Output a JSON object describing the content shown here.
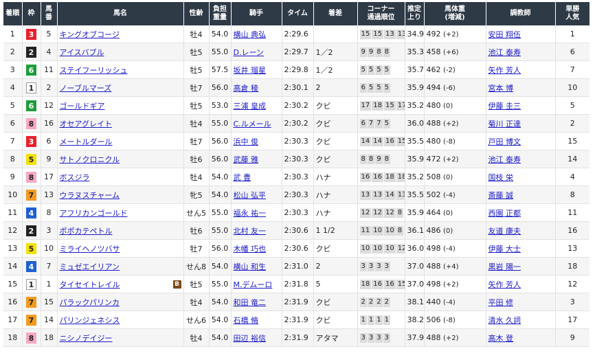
{
  "headers": [
    "着順",
    "枠",
    "馬番",
    "馬名",
    "性齢",
    "負担重量",
    "騎手",
    "タイム",
    "着差",
    "コーナー通過順位",
    "推定上り",
    "馬体重(増減)",
    "調教師",
    "単勝人気"
  ],
  "header_lines": {
    "h2": [
      "馬",
      "番"
    ],
    "h5": [
      "負担",
      "重量"
    ],
    "h9": [
      "コーナー",
      "通過順位"
    ],
    "h10": [
      "推定",
      "上り"
    ],
    "h11": [
      "馬体重",
      "(増減)"
    ],
    "h13": [
      "単勝",
      "人気"
    ]
  },
  "waku_colors": {
    "1": {
      "bg": "#ffffff",
      "fg": "#222222",
      "border": "#999999"
    },
    "2": {
      "bg": "#222222",
      "fg": "#ffffff",
      "border": "#222222"
    },
    "3": {
      "bg": "#e8202a",
      "fg": "#ffffff",
      "border": "#e8202a"
    },
    "4": {
      "bg": "#1f5fd0",
      "fg": "#ffffff",
      "border": "#1f5fd0"
    },
    "5": {
      "bg": "#f5e000",
      "fg": "#222222",
      "border": "#f5e000"
    },
    "6": {
      "bg": "#1e9e3a",
      "fg": "#ffffff",
      "border": "#1e9e3a"
    },
    "7": {
      "bg": "#f39a1e",
      "fg": "#222222",
      "border": "#f39a1e"
    },
    "8": {
      "bg": "#f6a8c2",
      "fg": "#222222",
      "border": "#f6a8c2"
    }
  },
  "rows": [
    {
      "rank": "1",
      "waku": "3",
      "num": "5",
      "horse": "キングオブコージ",
      "blinker": "",
      "sex_age": "牡4",
      "weight": "54.0",
      "jockey": "横山 典弘",
      "time": "2:29.6",
      "margin": "",
      "corners": [
        "15",
        "15",
        "13",
        "13"
      ],
      "last3f": "34.9",
      "body": "492",
      "diff": "(+2)",
      "trainer": "安田 翔伍",
      "pop": "1"
    },
    {
      "rank": "2",
      "waku": "2",
      "num": "4",
      "horse": "アイスバブル",
      "blinker": "",
      "sex_age": "牡5",
      "weight": "55.0",
      "jockey": "D.レーン",
      "time": "2:29.7",
      "margin": "1／2",
      "corners": [
        "9",
        "9",
        "8",
        "8"
      ],
      "last3f": "35.3",
      "body": "458",
      "diff": "(+6)",
      "trainer": "池江 泰寿",
      "pop": "6"
    },
    {
      "rank": "3",
      "waku": "6",
      "num": "11",
      "horse": "ステイフーリッシュ",
      "blinker": "",
      "sex_age": "牡5",
      "weight": "57.5",
      "jockey": "坂井 瑠星",
      "time": "2:29.8",
      "margin": "1／2",
      "corners": [
        "5",
        "5",
        "5",
        "5"
      ],
      "last3f": "35.7",
      "body": "462",
      "diff": "(-2)",
      "trainer": "矢作 芳人",
      "pop": "7"
    },
    {
      "rank": "4",
      "waku": "1",
      "num": "2",
      "horse": "ノーブルマーズ",
      "blinker": "",
      "sex_age": "牡7",
      "weight": "56.0",
      "jockey": "高倉 稜",
      "time": "2:30.1",
      "margin": "2",
      "corners": [
        "6",
        "5",
        "5",
        "5"
      ],
      "last3f": "35.9",
      "body": "494",
      "diff": "(-6)",
      "trainer": "宮本 博",
      "pop": "10"
    },
    {
      "rank": "5",
      "waku": "6",
      "num": "12",
      "horse": "ゴールドギア",
      "blinker": "",
      "sex_age": "牡5",
      "weight": "53.0",
      "jockey": "三浦 皇成",
      "time": "2:30.2",
      "margin": "クビ",
      "corners": [
        "17",
        "18",
        "15",
        "17"
      ],
      "last3f": "35.2",
      "body": "480",
      "diff": "(0)",
      "trainer": "伊藤 圭三",
      "pop": "5"
    },
    {
      "rank": "6",
      "waku": "8",
      "num": "16",
      "horse": "オセアグレイト",
      "blinker": "",
      "sex_age": "牡4",
      "weight": "55.0",
      "jockey": "C.ルメール",
      "time": "2:30.2",
      "margin": "クビ",
      "corners": [
        "6",
        "7",
        "7",
        "5"
      ],
      "last3f": "36.0",
      "body": "488",
      "diff": "(+2)",
      "trainer": "菊川 正達",
      "pop": "2"
    },
    {
      "rank": "7",
      "waku": "3",
      "num": "6",
      "horse": "メートルダール",
      "blinker": "",
      "sex_age": "牡7",
      "weight": "56.0",
      "jockey": "浜中 俊",
      "time": "2:30.3",
      "margin": "クビ",
      "corners": [
        "14",
        "14",
        "16",
        "15"
      ],
      "last3f": "35.5",
      "body": "480",
      "diff": "(-8)",
      "trainer": "戸田 博文",
      "pop": "15"
    },
    {
      "rank": "8",
      "waku": "5",
      "num": "9",
      "horse": "サトノクロニクル",
      "blinker": "",
      "sex_age": "牡6",
      "weight": "56.0",
      "jockey": "武藤 雅",
      "time": "2:30.3",
      "margin": "クビ",
      "corners": [
        "8",
        "8",
        "9",
        "8"
      ],
      "last3f": "35.9",
      "body": "472",
      "diff": "(+2)",
      "trainer": "池江 泰寿",
      "pop": "14"
    },
    {
      "rank": "9",
      "waku": "8",
      "num": "17",
      "horse": "ボスジラ",
      "blinker": "",
      "sex_age": "牡4",
      "weight": "54.0",
      "jockey": "武 豊",
      "time": "2:30.3",
      "margin": "ハナ",
      "corners": [
        "16",
        "16",
        "18",
        "18"
      ],
      "last3f": "35.2",
      "body": "508",
      "diff": "(0)",
      "trainer": "国枝 栄",
      "pop": "4"
    },
    {
      "rank": "10",
      "waku": "7",
      "num": "13",
      "horse": "ウラヌスチャーム",
      "blinker": "",
      "sex_age": "牝5",
      "weight": "54.0",
      "jockey": "松山 弘平",
      "time": "2:30.3",
      "margin": "ハナ",
      "corners": [
        "13",
        "13",
        "14",
        "13"
      ],
      "last3f": "35.5",
      "body": "502",
      "diff": "(-4)",
      "trainer": "斎藤 誠",
      "pop": "8"
    },
    {
      "rank": "11",
      "waku": "4",
      "num": "8",
      "horse": "アフリカンゴールド",
      "blinker": "",
      "sex_age": "せん5",
      "weight": "55.0",
      "jockey": "福永 祐一",
      "time": "2:30.3",
      "margin": "ハナ",
      "corners": [
        "12",
        "12",
        "12",
        "8"
      ],
      "last3f": "35.9",
      "body": "464",
      "diff": "(0)",
      "trainer": "西園 正都",
      "pop": "11"
    },
    {
      "rank": "12",
      "waku": "2",
      "num": "3",
      "horse": "ポポカテペトル",
      "blinker": "",
      "sex_age": "牡6",
      "weight": "55.0",
      "jockey": "北村 友一",
      "time": "2:30.6",
      "margin": "1 1/2",
      "corners": [
        "11",
        "10",
        "10",
        "8"
      ],
      "last3f": "36.1",
      "body": "486",
      "diff": "(0)",
      "trainer": "友道 康夫",
      "pop": "16"
    },
    {
      "rank": "13",
      "waku": "5",
      "num": "10",
      "horse": "ミライヘノツバサ",
      "blinker": "",
      "sex_age": "牡7",
      "weight": "56.0",
      "jockey": "木幡 巧也",
      "time": "2:30.6",
      "margin": "クビ",
      "corners": [
        "10",
        "10",
        "10",
        "12"
      ],
      "last3f": "36.0",
      "body": "498",
      "diff": "(-4)",
      "trainer": "伊藤 大士",
      "pop": "13"
    },
    {
      "rank": "14",
      "waku": "4",
      "num": "7",
      "horse": "ミュゼエイリアン",
      "blinker": "",
      "sex_age": "せん8",
      "weight": "54.0",
      "jockey": "横山 和生",
      "time": "2:31.0",
      "margin": "2",
      "corners": [
        "3",
        "3",
        "3",
        "3"
      ],
      "last3f": "37.0",
      "body": "488",
      "diff": "(+4)",
      "trainer": "黒岩 陽一",
      "pop": "18"
    },
    {
      "rank": "15",
      "waku": "1",
      "num": "1",
      "horse": "タイセイトレイル",
      "blinker": "B",
      "sex_age": "牡5",
      "weight": "55.0",
      "jockey": "M.デムーロ",
      "time": "2:31.8",
      "margin": "5",
      "corners": [
        "18",
        "16",
        "16",
        "15"
      ],
      "last3f": "37.0",
      "body": "498",
      "diff": "(+2)",
      "trainer": "矢作 芳人",
      "pop": "12"
    },
    {
      "rank": "16",
      "waku": "7",
      "num": "15",
      "horse": "パラックパリンカ",
      "blinker": "",
      "sex_age": "牡4",
      "weight": "54.0",
      "jockey": "和田 竜二",
      "time": "2:31.9",
      "margin": "クビ",
      "corners": [
        "2",
        "2",
        "2",
        "2"
      ],
      "last3f": "38.1",
      "body": "440",
      "diff": "(-4)",
      "trainer": "平田 修",
      "pop": "3"
    },
    {
      "rank": "17",
      "waku": "7",
      "num": "14",
      "horse": "パリンジェネシス",
      "blinker": "",
      "sex_age": "せん6",
      "weight": "54.0",
      "jockey": "石橋 脩",
      "time": "2:31.9",
      "margin": "クビ",
      "corners": [
        "1",
        "1",
        "1",
        "1"
      ],
      "last3f": "38.2",
      "body": "506",
      "diff": "(-8)",
      "trainer": "清水 久詞",
      "pop": "17"
    },
    {
      "rank": "18",
      "waku": "8",
      "num": "18",
      "horse": "ニシノデイジー",
      "blinker": "",
      "sex_age": "牡4",
      "weight": "54.0",
      "jockey": "田辺 裕信",
      "time": "2:31.9",
      "margin": "アタマ",
      "corners": [
        "3",
        "3",
        "3",
        "3"
      ],
      "last3f": "37.9",
      "body": "488",
      "diff": "(+2)",
      "trainer": "高木 登",
      "pop": "9"
    }
  ]
}
